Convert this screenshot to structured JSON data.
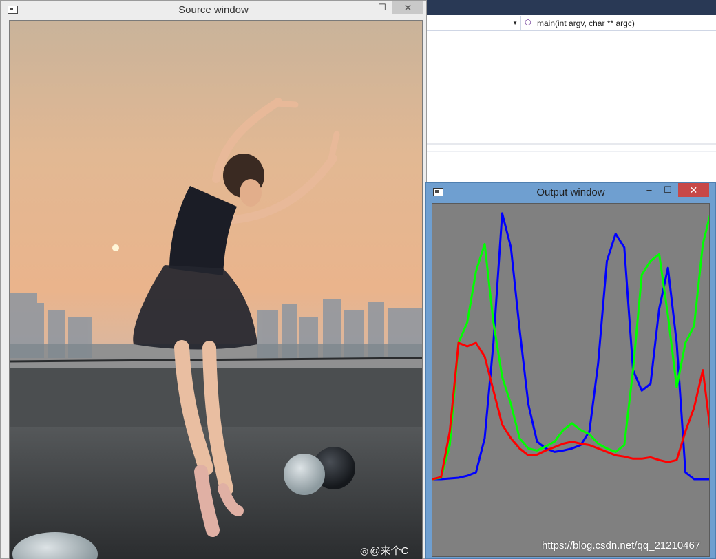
{
  "ide": {
    "scope_dropdown_value": "",
    "member_dropdown_value": "main(int argv, char ** argc)"
  },
  "source_window": {
    "title": "Source window",
    "minimize_glyph": "–",
    "maximize_glyph": "☐",
    "close_glyph": "✕",
    "watermark": "@来个C",
    "weibo_icon": "weibo-icon"
  },
  "output_window": {
    "title": "Output window",
    "minimize_glyph": "–",
    "maximize_glyph": "☐",
    "close_glyph": "✕",
    "background_color": "#808080"
  },
  "url_watermark": "https://blog.csdn.net/qq_21210467",
  "chart_data": {
    "type": "line",
    "title": "",
    "xlabel": "",
    "ylabel": "",
    "xlim": [
      0,
      255
    ],
    "ylim": [
      0,
      400
    ],
    "grid": false,
    "x": [
      0,
      8,
      16,
      24,
      32,
      40,
      48,
      56,
      64,
      72,
      80,
      88,
      96,
      104,
      112,
      120,
      128,
      136,
      144,
      152,
      160,
      168,
      176,
      184,
      192,
      200,
      208,
      216,
      224,
      232,
      240,
      248,
      255
    ],
    "series": [
      {
        "color": "#0000ff",
        "values": [
          0,
          0,
          1,
          2,
          5,
          10,
          60,
          200,
          390,
          340,
          220,
          110,
          55,
          45,
          40,
          42,
          45,
          50,
          70,
          170,
          320,
          360,
          340,
          160,
          130,
          140,
          250,
          310,
          200,
          10,
          0,
          0,
          0
        ]
      },
      {
        "color": "#00ff00",
        "values": [
          0,
          2,
          50,
          200,
          230,
          305,
          345,
          230,
          150,
          110,
          60,
          45,
          42,
          48,
          55,
          72,
          82,
          72,
          66,
          52,
          45,
          40,
          50,
          160,
          300,
          320,
          330,
          240,
          135,
          200,
          225,
          345,
          390
        ]
      },
      {
        "color": "#ff0000",
        "values": [
          0,
          3,
          70,
          200,
          195,
          200,
          180,
          130,
          80,
          60,
          45,
          35,
          36,
          42,
          47,
          52,
          55,
          52,
          50,
          45,
          40,
          35,
          33,
          30,
          30,
          32,
          28,
          25,
          28,
          70,
          105,
          160,
          70
        ]
      }
    ]
  }
}
